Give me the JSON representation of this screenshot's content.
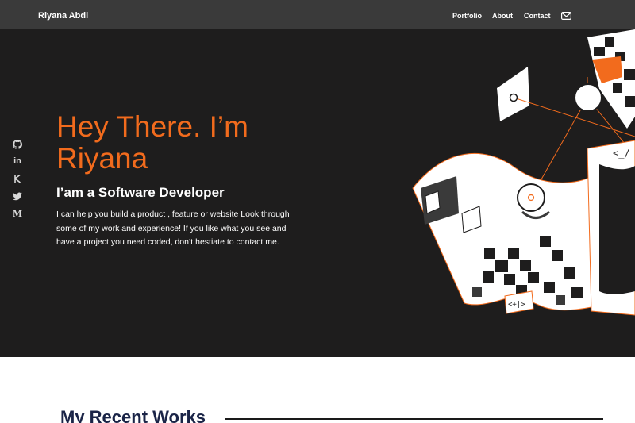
{
  "header": {
    "brand": "Riyana Abdi",
    "nav": {
      "portfolio": "Portfolio",
      "about": "About",
      "contact": "Contact"
    },
    "mail_icon": "envelope-icon"
  },
  "social": [
    {
      "icon": "github-icon"
    },
    {
      "icon": "linkedin-icon",
      "text": "in"
    },
    {
      "icon": "kaggle-icon"
    },
    {
      "icon": "twitter-icon"
    },
    {
      "icon": "medium-icon",
      "text": "M"
    }
  ],
  "hero": {
    "title": "Hey There. I’m Riyana",
    "subtitle": "I’am a Software Developer",
    "description": "I can help you build a product , feature or website Look through some of my work and experience! If you like what you see and have a project you need coded, don’t hestiate to contact me.",
    "code_tag_1": "<_/",
    "code_tag_2": "<+|>"
  },
  "works": {
    "title": "My Recent Works"
  },
  "colors": {
    "accent": "#f26b1d",
    "hero_bg": "#1e1d1d",
    "header_bg": "#3a3a3a",
    "heading_navy": "#1a2447"
  }
}
